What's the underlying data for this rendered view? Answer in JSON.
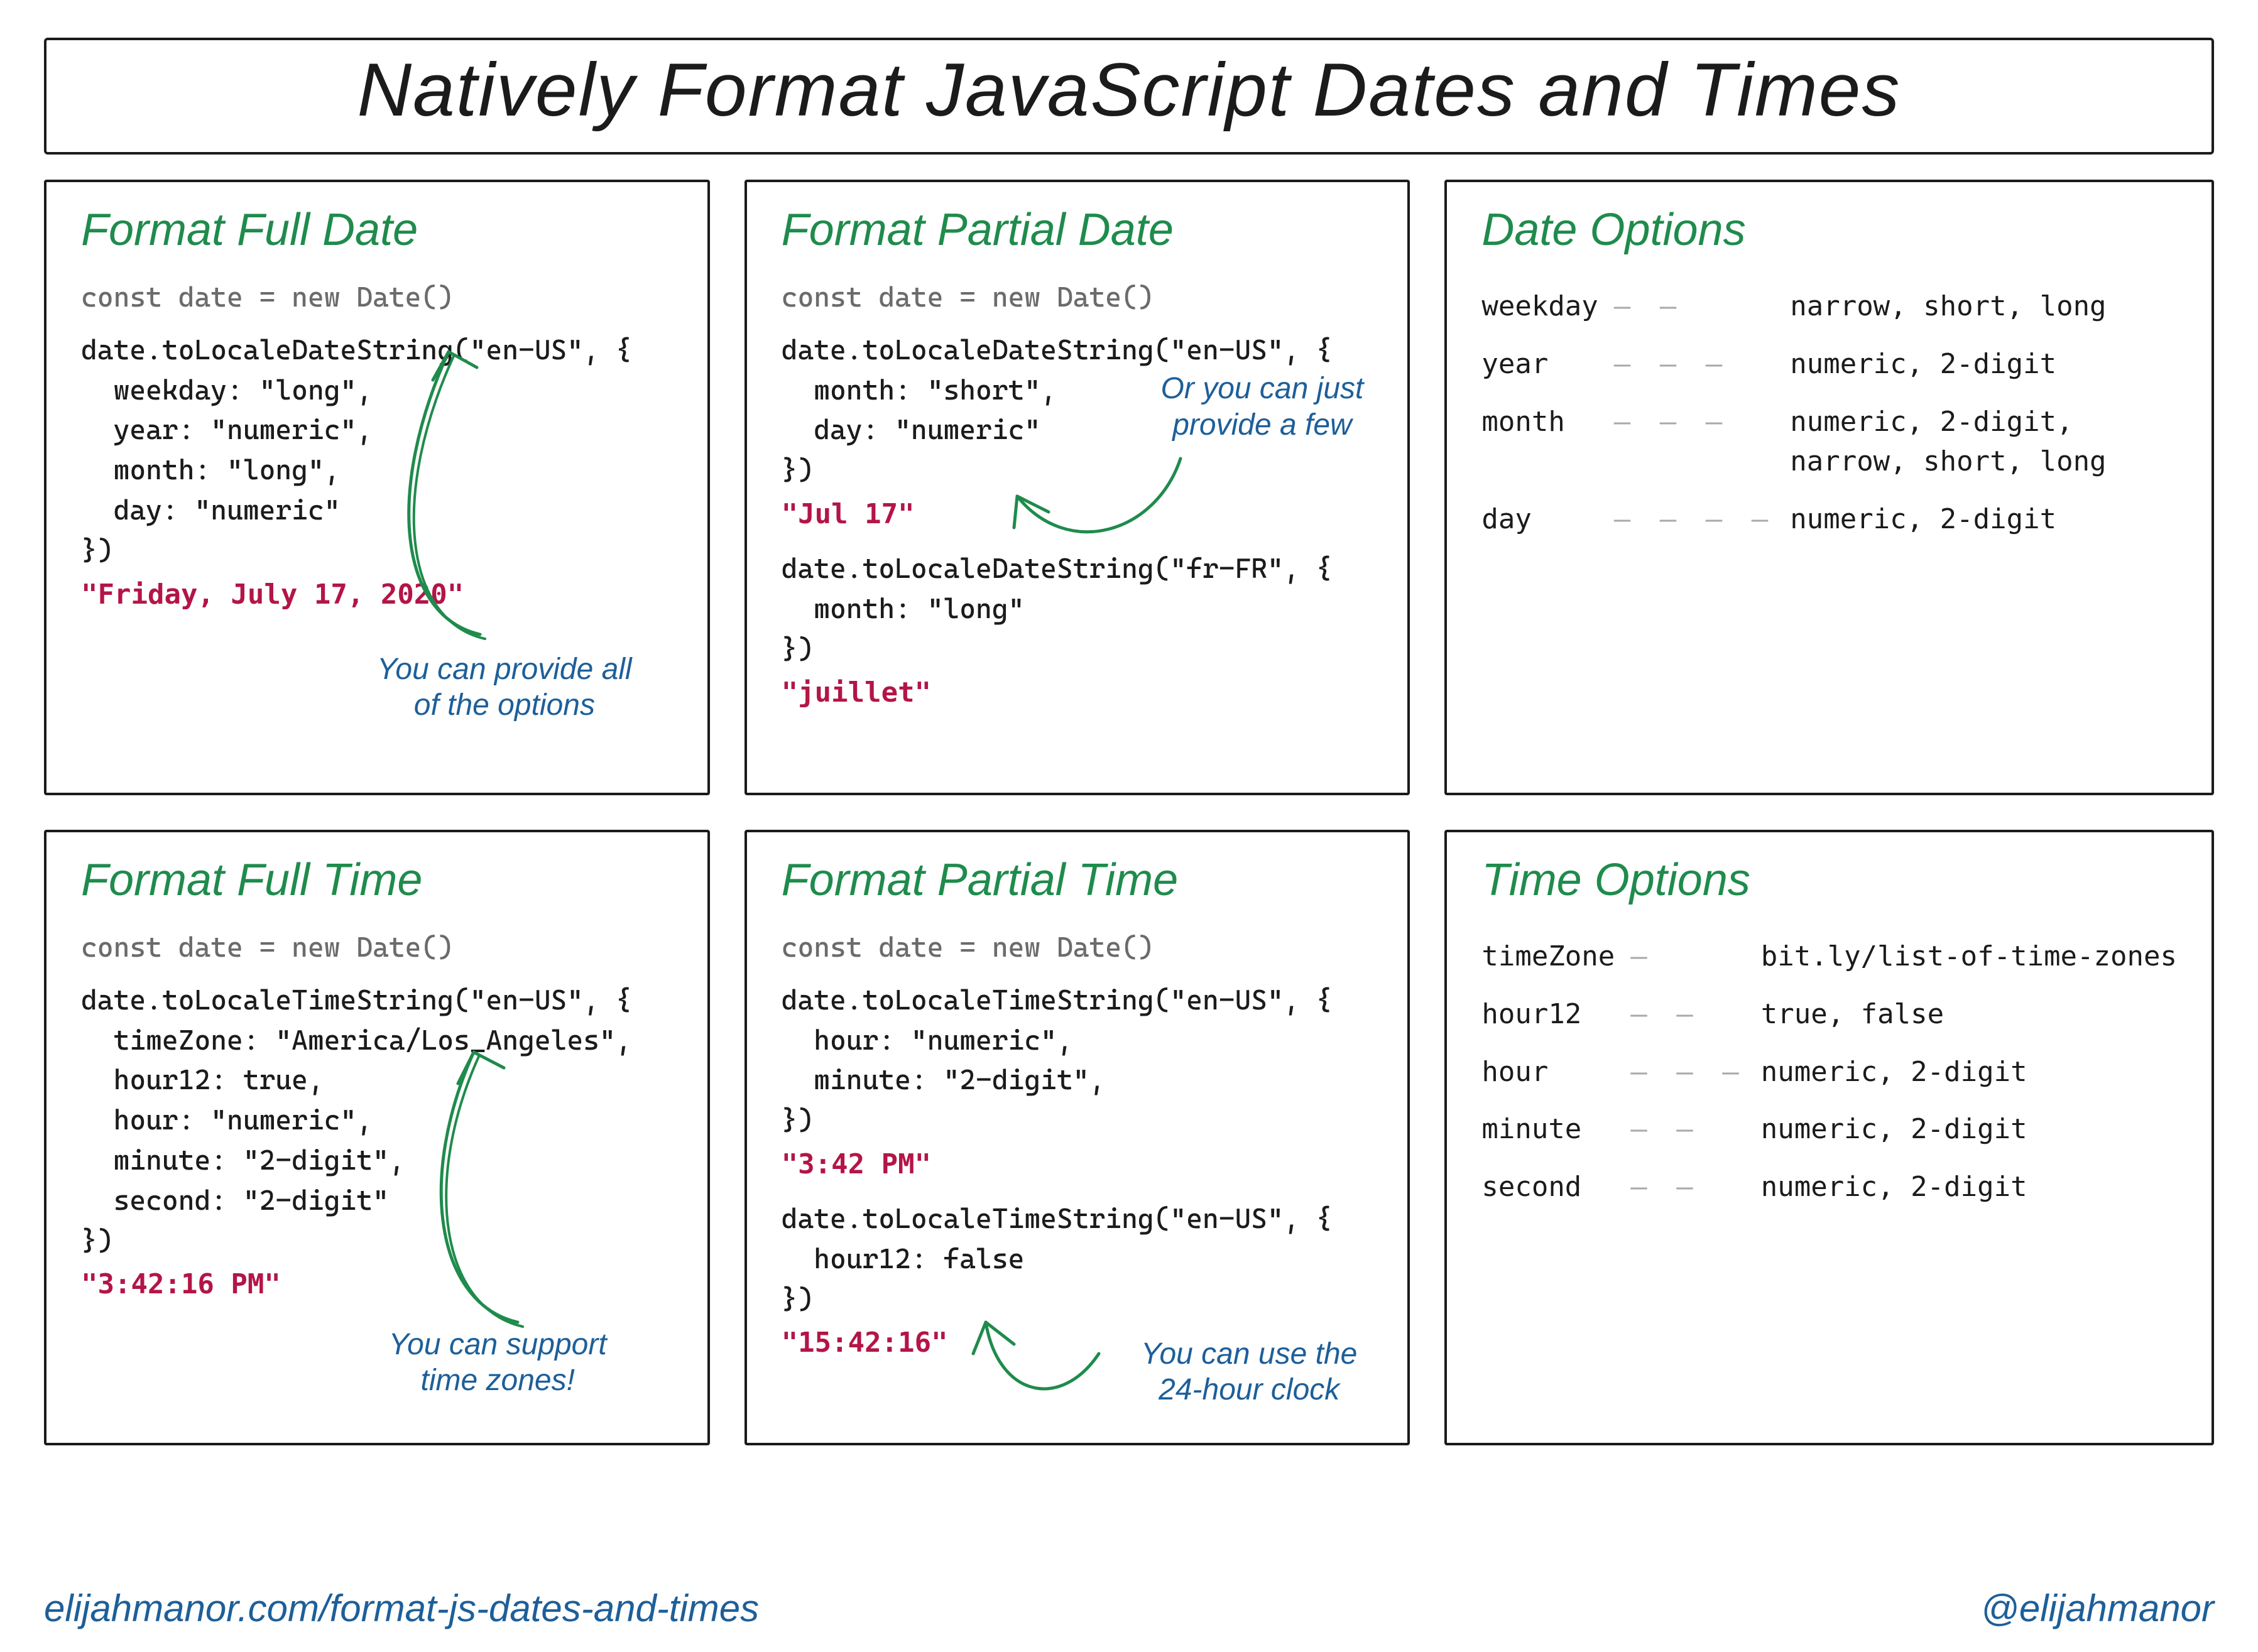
{
  "title": "Natively Format JavaScript Dates and Times",
  "cards": {
    "full_date": {
      "heading": "Format Full Date",
      "decl": "const date = new Date()",
      "code": "date.toLocaleDateString(\"en-US\", {\n  weekday: \"long\",\n  year: \"numeric\",\n  month: \"long\",\n  day: \"numeric\"\n})",
      "result": "\"Friday, July 17, 2020\"",
      "note": "You can provide all\nof the options"
    },
    "partial_date": {
      "heading": "Format Partial Date",
      "decl": "const date = new Date()",
      "code1": "date.toLocaleDateString(\"en-US\", {\n  month: \"short\",\n  day: \"numeric\"\n})",
      "result1": "\"Jul 17\"",
      "code2": "date.toLocaleDateString(\"fr-FR\", {\n  month: \"long\"\n})",
      "result2": "\"juillet\"",
      "note": "Or you can just\nprovide a few"
    },
    "date_options": {
      "heading": "Date Options",
      "rows": [
        {
          "key": "weekday",
          "dash": "— —",
          "val": "narrow, short, long"
        },
        {
          "key": "year",
          "dash": "— — —",
          "val": "numeric, 2-digit"
        },
        {
          "key": "month",
          "dash": "— — —",
          "val": "numeric, 2-digit,\nnarrow, short, long"
        },
        {
          "key": "day",
          "dash": "— — — —",
          "val": "numeric, 2-digit"
        }
      ]
    },
    "full_time": {
      "heading": "Format Full Time",
      "decl": "const date = new Date()",
      "code": "date.toLocaleTimeString(\"en-US\", {\n  timeZone: \"America/Los_Angeles\",\n  hour12: true,\n  hour: \"numeric\",\n  minute: \"2-digit\",\n  second: \"2-digit\"\n})",
      "result": "\"3:42:16 PM\"",
      "note": "You can support\ntime zones!"
    },
    "partial_time": {
      "heading": "Format Partial Time",
      "decl": "const date = new Date()",
      "code1": "date.toLocaleTimeString(\"en-US\", {\n  hour: \"numeric\",\n  minute: \"2-digit\",\n})",
      "result1": "\"3:42 PM\"",
      "code2": "date.toLocaleTimeString(\"en-US\", {\n  hour12: false\n})",
      "result2": "\"15:42:16\"",
      "note": "You can use the\n24-hour clock"
    },
    "time_options": {
      "heading": "Time Options",
      "rows": [
        {
          "key": "timeZone",
          "dash": "—",
          "val": "bit.ly/list-of-time-zones"
        },
        {
          "key": "hour12",
          "dash": "— —",
          "val": "true, false"
        },
        {
          "key": "hour",
          "dash": "— — —",
          "val": "numeric, 2-digit"
        },
        {
          "key": "minute",
          "dash": "— —",
          "val": "numeric, 2-digit"
        },
        {
          "key": "second",
          "dash": "— —",
          "val": "numeric, 2-digit"
        }
      ]
    }
  },
  "footer": {
    "url": "elijahmanor.com/format-js-dates-and-times",
    "handle": "@elijahmanor"
  }
}
